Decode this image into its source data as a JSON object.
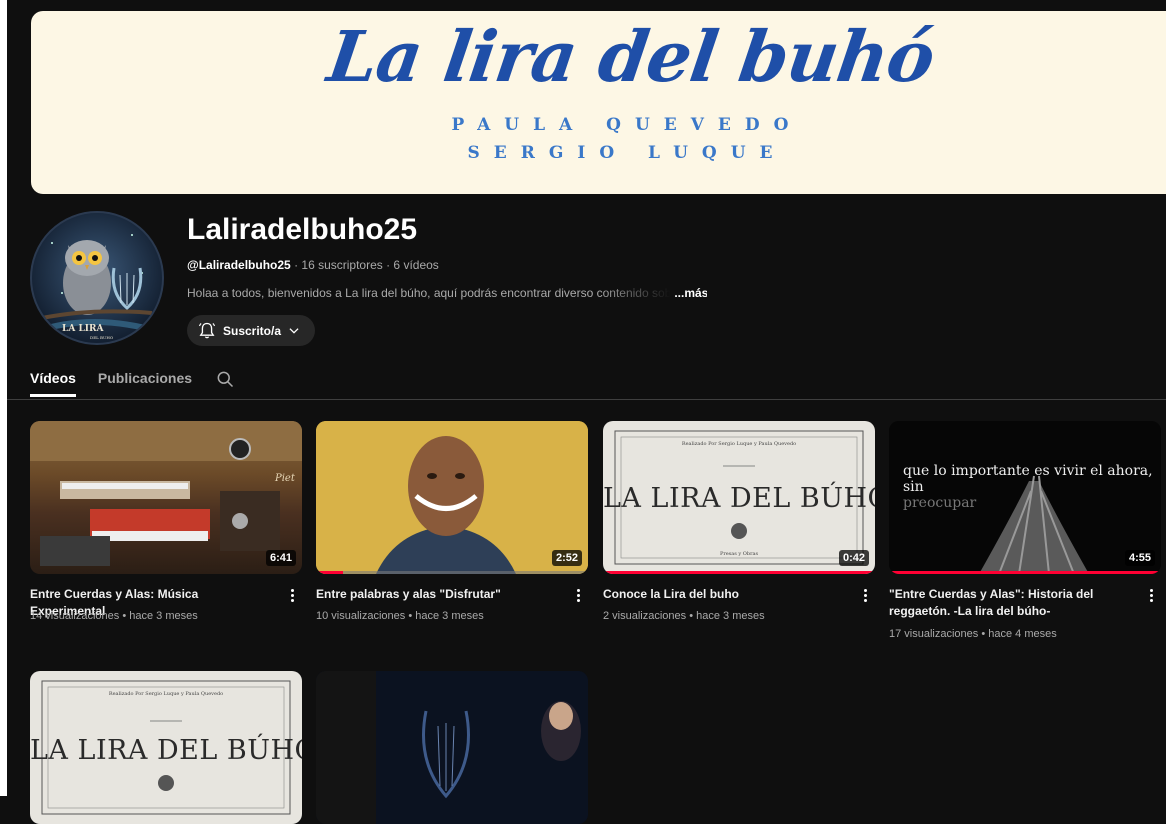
{
  "banner": {
    "title": "La lira del buhó",
    "line1": "PAULA QUEVEDO",
    "line2": "SERGIO LUQUE"
  },
  "channel": {
    "name": "Laliradelbuho25",
    "handle": "@Laliradelbuho25",
    "stats": " · 16 suscriptores · 6 vídeos",
    "description": "Holaa a todos, bienvenidos a La lira del búho, aquí podrás encontrar diverso contenido sob",
    "more_label": "...más",
    "avatar_text1": "LA LIRA",
    "avatar_text2": "DEL BUHO",
    "subscribe_label": "Suscrito/a"
  },
  "tabs": [
    {
      "label": "Vídeos",
      "active": true
    },
    {
      "label": "Publicaciones",
      "active": false
    }
  ],
  "videos": [
    {
      "title": "Entre Cuerdas y Alas: Música Experimental",
      "meta": "14 visualizaciones • hace 3 meses",
      "duration": "6:41",
      "progress": 0
    },
    {
      "title": "Entre palabras y alas \"Disfrutar\"",
      "meta": "10 visualizaciones • hace 3 meses",
      "duration": "2:52",
      "progress": 0.1
    },
    {
      "title": "Conoce la Lira del buho",
      "meta": "2 visualizaciones • hace 3 meses",
      "duration": "0:42",
      "progress": 1.0
    },
    {
      "title": "\"Entre Cuerdas y Alas\": Historia del reggaetón. -La lira del búho-",
      "meta": "17 visualizaciones • hace 4 meses",
      "duration": "4:55",
      "progress": 1.0
    },
    {
      "title": "",
      "meta": "",
      "duration": "",
      "progress": 0
    },
    {
      "title": "",
      "meta": "",
      "duration": "",
      "progress": 0
    }
  ],
  "thumbs": {
    "lira_title": "LA LIRA DEL BÚHO",
    "lira_top": "Realizado Por Sergio Luque y Paula Quevedo",
    "lira_bottom": "Presas y Obras",
    "t1_sign": "Piet",
    "t4_caption_a": "que lo importante es vivir el ahora, sin",
    "t4_caption_b": "preocupar"
  },
  "colors": {
    "accent": "#ff0033",
    "banner_bg": "#fdf7e5",
    "banner_title": "#1f4fa8"
  }
}
